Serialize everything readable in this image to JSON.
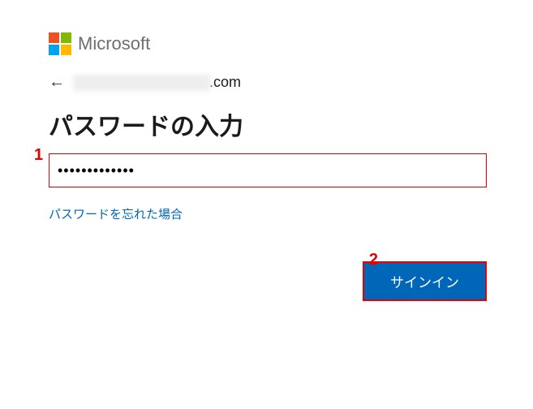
{
  "brand": {
    "name": "Microsoft"
  },
  "identity": {
    "email_visible_suffix": ".com"
  },
  "title": "パスワードの入力",
  "password": {
    "value": "•••••••••••••"
  },
  "links": {
    "forgot": "パスワードを忘れた場合"
  },
  "buttons": {
    "signin": "サインイン"
  },
  "annotations": {
    "marker1": "1",
    "marker2": "2"
  }
}
